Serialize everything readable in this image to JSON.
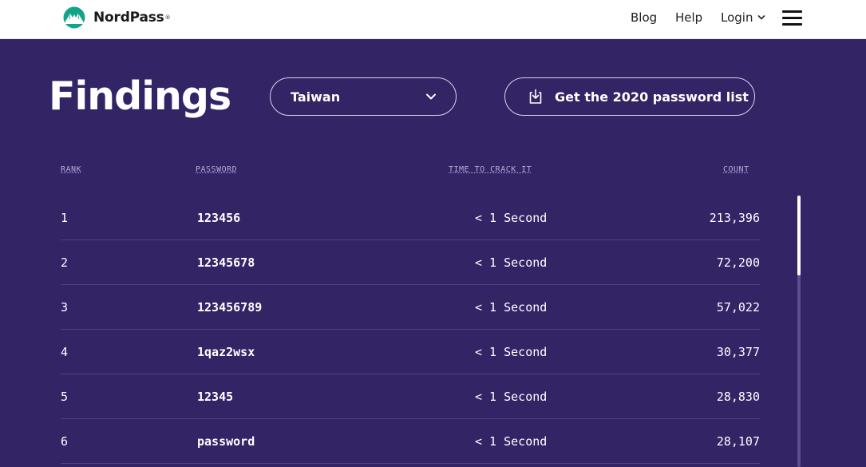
{
  "brand": {
    "name": "NordPass",
    "reg": "®",
    "logo_icon": "nordpass-mountain-icon",
    "logo_color": "#12a488"
  },
  "nav": {
    "blog": "Blog",
    "help": "Help",
    "login": "Login"
  },
  "hero": {
    "title": "Findings",
    "country_selected": "Taiwan",
    "download_label": "Get the 2020 password list"
  },
  "table": {
    "headers": {
      "rank": "RANK",
      "password": "PASSWORD",
      "time": "TIME TO CRACK IT",
      "count": "COUNT"
    },
    "rows": [
      {
        "rank": "1",
        "password": "123456",
        "time": "< 1 Second",
        "count": "213,396"
      },
      {
        "rank": "2",
        "password": "12345678",
        "time": "< 1 Second",
        "count": "72,200"
      },
      {
        "rank": "3",
        "password": "123456789",
        "time": "< 1 Second",
        "count": "57,022"
      },
      {
        "rank": "4",
        "password": "1qaz2wsx",
        "time": "< 1 Second",
        "count": "30,377"
      },
      {
        "rank": "5",
        "password": "12345",
        "time": "< 1 Second",
        "count": "28,830"
      },
      {
        "rank": "6",
        "password": "password",
        "time": "< 1 Second",
        "count": "28,107"
      }
    ]
  },
  "colors": {
    "background": "#332466",
    "header_bg": "#ffffff",
    "divider": "#4e4383"
  }
}
